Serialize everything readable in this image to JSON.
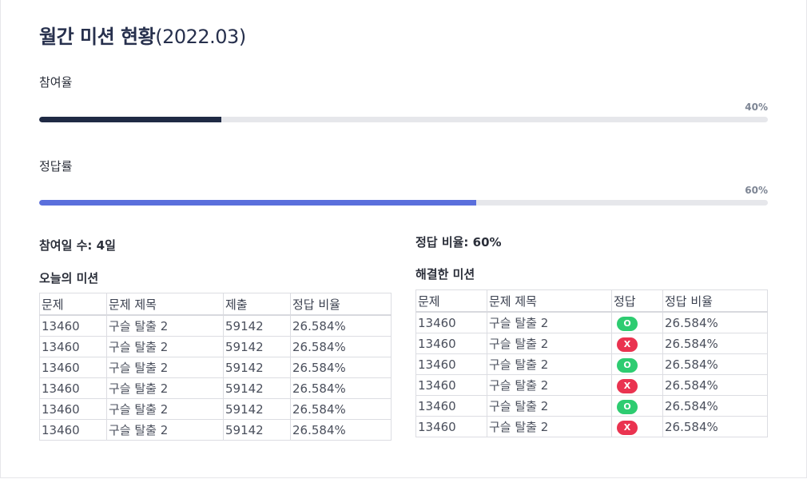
{
  "title": {
    "main": "월간 미션 현황",
    "period": "(2022.03)"
  },
  "participation": {
    "label": "참여율",
    "percent_text": "40%",
    "value": 0.25,
    "color": "#1f2a44"
  },
  "accuracy": {
    "label": "정답률",
    "percent_text": "60%",
    "value": 0.6,
    "color": "#5a6fdc"
  },
  "stats": {
    "participation_days": "참여일 수: 4일",
    "answer_ratio": "정답 비율: 60%"
  },
  "today": {
    "title": "오늘의 미션",
    "headers": [
      "문제",
      "문제 제목",
      "제출",
      "정답 비율"
    ],
    "rows": [
      [
        "13460",
        "구슬 탈출 2",
        "59142",
        "26.584%"
      ],
      [
        "13460",
        "구슬 탈출 2",
        "59142",
        "26.584%"
      ],
      [
        "13460",
        "구슬 탈출 2",
        "59142",
        "26.584%"
      ],
      [
        "13460",
        "구슬 탈출 2",
        "59142",
        "26.584%"
      ],
      [
        "13460",
        "구슬 탈출 2",
        "59142",
        "26.584%"
      ],
      [
        "13460",
        "구슬 탈출 2",
        "59142",
        "26.584%"
      ]
    ]
  },
  "solved": {
    "title": "해결한 미션",
    "headers": [
      "문제",
      "문제 제목",
      "정답",
      "정답 비율"
    ],
    "rows": [
      {
        "id": "13460",
        "name": "구슬 탈출 2",
        "result": "O",
        "ratio": "26.584%"
      },
      {
        "id": "13460",
        "name": "구슬 탈출 2",
        "result": "X",
        "ratio": "26.584%"
      },
      {
        "id": "13460",
        "name": "구슬 탈출 2",
        "result": "O",
        "ratio": "26.584%"
      },
      {
        "id": "13460",
        "name": "구슬 탈출 2",
        "result": "X",
        "ratio": "26.584%"
      },
      {
        "id": "13460",
        "name": "구슬 탈출 2",
        "result": "O",
        "ratio": "26.584%"
      },
      {
        "id": "13460",
        "name": "구슬 탈출 2",
        "result": "X",
        "ratio": "26.584%"
      }
    ]
  }
}
